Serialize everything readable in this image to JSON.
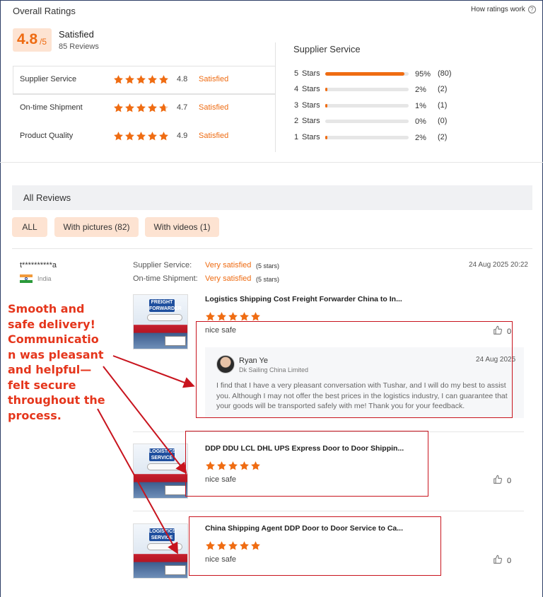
{
  "header": {
    "title": "Overall Ratings",
    "how_link": "How ratings work",
    "score": "4.8",
    "score_suffix": "/5",
    "summary": "Satisfied",
    "review_count": "85 Reviews"
  },
  "categories": [
    {
      "label": "Supplier Service",
      "value": "4.8",
      "rating_text": "Satisfied",
      "stars": 5
    },
    {
      "label": "On-time Shipment",
      "value": "4.7",
      "rating_text": "Satisfied",
      "stars": 4.7
    },
    {
      "label": "Product Quality",
      "value": "4.9",
      "rating_text": "Satisfied",
      "stars": 5
    }
  ],
  "distribution": {
    "title": "Supplier Service",
    "rows": [
      {
        "label": "5",
        "stars_word": "Stars",
        "percent": "95%",
        "count": "(80)",
        "fraction": 0.95
      },
      {
        "label": "4",
        "stars_word": "Stars",
        "percent": "2%",
        "count": "(2)",
        "fraction": 0.02
      },
      {
        "label": "3",
        "stars_word": "Stars",
        "percent": "1%",
        "count": "(1)",
        "fraction": 0.01
      },
      {
        "label": "2",
        "stars_word": "Stars",
        "percent": "0%",
        "count": "(0)",
        "fraction": 0.0
      },
      {
        "label": "1",
        "stars_word": "Stars",
        "percent": "2%",
        "count": "(2)",
        "fraction": 0.02
      }
    ]
  },
  "reviews_section": {
    "title": "All Reviews",
    "filters": [
      "ALL",
      "With pictures (82)",
      "With videos (1)"
    ]
  },
  "review": {
    "user": "t**********a",
    "country": "India",
    "supplier_service_label": "Supplier Service:",
    "supplier_service_value": "Very satisfied",
    "supplier_service_stars": "(5 stars)",
    "shipment_label": "On-time Shipment:",
    "shipment_value": "Very satisfied",
    "shipment_stars": "(5 stars)",
    "date": "24 Aug 2025 20:22",
    "items": [
      {
        "title": "Logistics Shipping Cost Freight Forwarder China to In...",
        "thumb_label": "FREIGHT FORWARDER",
        "comment": "nice safe",
        "likes": "0",
        "stars": 5
      },
      {
        "title": "DDP DDU LCL DHL UPS Express Door to Door Shippin...",
        "thumb_label": "LOGISTICS SERVICE",
        "comment": "nice safe",
        "likes": "0",
        "stars": 5
      },
      {
        "title": "China Shipping Agent DDP Door to Door Service to Ca...",
        "thumb_label": "LOGISTICS SERVICE",
        "comment": "nice safe",
        "likes": "0",
        "stars": 5
      }
    ],
    "reply": {
      "name": "Ryan Ye",
      "company": "Dk Sailing China Limited",
      "date": "24 Aug 2025",
      "text": "I find that I have a very pleasant conversation with Tushar, and I will do my best to assist you. Although I may not offer the best prices in the logistics industry, I can guarantee that your goods will be transported safely with me! Thank you for your feedback."
    }
  },
  "annotation": {
    "text": "Smooth and safe delivery! Communicatio n was pleasant and helpful—felt secure throughout the  process."
  },
  "colors": {
    "accent": "#ef6c12",
    "annotation": "#e5361c",
    "highlight_box": "#c8141e"
  }
}
